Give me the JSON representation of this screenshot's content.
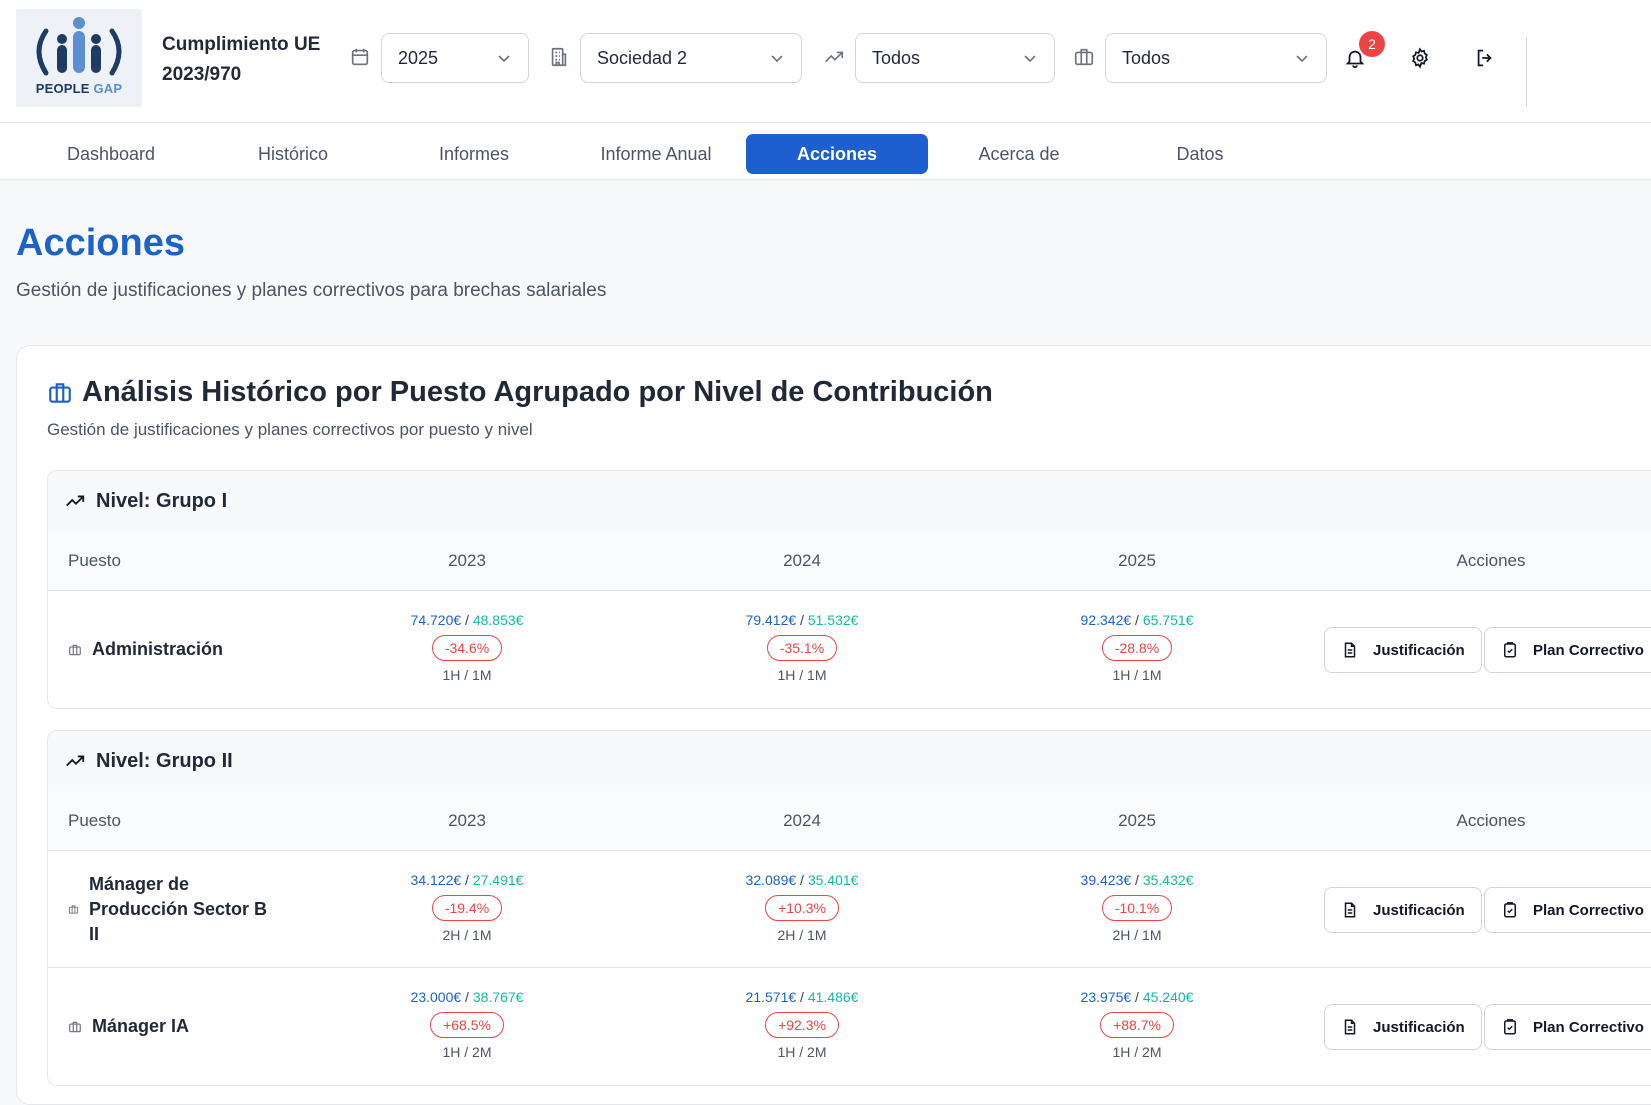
{
  "app": {
    "logo_text_main": "PEOPLE",
    "logo_text_accent": "GAP",
    "title": "Cumplimiento UE 2023/970"
  },
  "filters": {
    "year": "2025",
    "company": "Sociedad 2",
    "level": "Todos",
    "position": "Todos"
  },
  "notifications": {
    "count": "2"
  },
  "tabs": [
    {
      "label": "Dashboard",
      "active": false
    },
    {
      "label": "Histórico",
      "active": false
    },
    {
      "label": "Informes",
      "active": false
    },
    {
      "label": "Informe Anual",
      "active": false
    },
    {
      "label": "Acciones",
      "active": true
    },
    {
      "label": "Acerca de",
      "active": false
    },
    {
      "label": "Datos",
      "active": false
    }
  ],
  "page": {
    "title": "Acciones",
    "subtitle": "Gestión de justificaciones y planes correctivos para brechas salariales"
  },
  "card": {
    "title": "Análisis Histórico por Puesto Agrupado por Nivel de Contribución",
    "subtitle": "Gestión de justificaciones y planes correctivos por puesto y nivel"
  },
  "table_headers": {
    "puesto": "Puesto",
    "y1": "2023",
    "y2": "2024",
    "y3": "2025",
    "acciones": "Acciones"
  },
  "buttons": {
    "justificacion": "Justificación",
    "plan": "Plan Correctivo"
  },
  "groups": [
    {
      "title": "Nivel: Grupo I",
      "rows": [
        {
          "puesto": "Administración",
          "years": [
            {
              "h": "74.720€",
              "m": "48.853€",
              "gap": "-34.6%",
              "count": "1H / 1M"
            },
            {
              "h": "79.412€",
              "m": "51.532€",
              "gap": "-35.1%",
              "count": "1H / 1M"
            },
            {
              "h": "92.342€",
              "m": "65.751€",
              "gap": "-28.8%",
              "count": "1H / 1M"
            }
          ]
        }
      ]
    },
    {
      "title": "Nivel: Grupo II",
      "rows": [
        {
          "puesto": "Mánager de Producción Sector B II",
          "years": [
            {
              "h": "34.122€",
              "m": "27.491€",
              "gap": "-19.4%",
              "count": "2H / 1M"
            },
            {
              "h": "32.089€",
              "m": "35.401€",
              "gap": "+10.3%",
              "count": "2H / 1M"
            },
            {
              "h": "39.423€",
              "m": "35.432€",
              "gap": "-10.1%",
              "count": "2H / 1M"
            }
          ]
        },
        {
          "puesto": "Mánager IA",
          "years": [
            {
              "h": "23.000€",
              "m": "38.767€",
              "gap": "+68.5%",
              "count": "1H / 2M"
            },
            {
              "h": "21.571€",
              "m": "41.486€",
              "gap": "+92.3%",
              "count": "1H / 2M"
            },
            {
              "h": "23.975€",
              "m": "45.240€",
              "gap": "+88.7%",
              "count": "1H / 2M"
            }
          ]
        }
      ]
    }
  ]
}
